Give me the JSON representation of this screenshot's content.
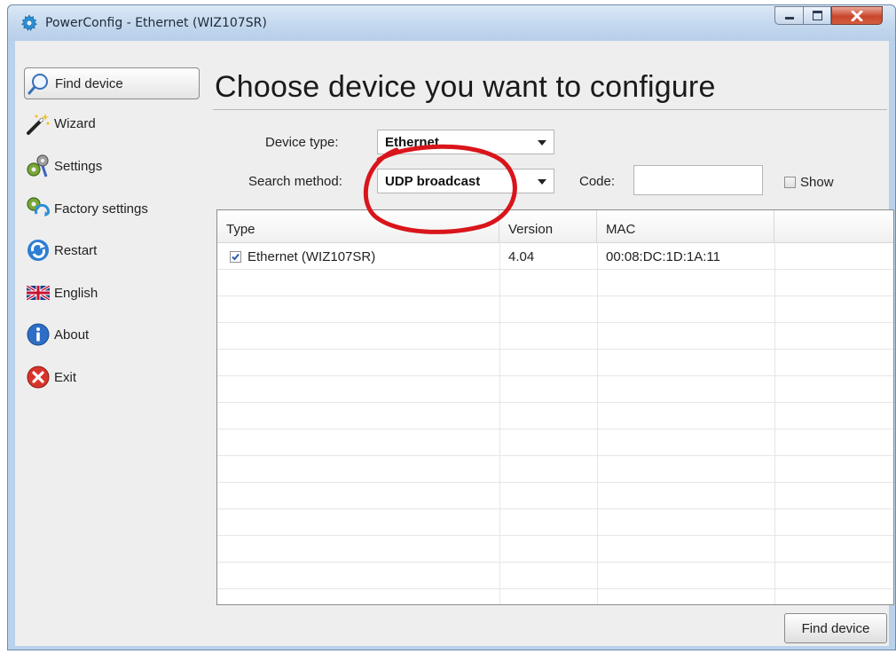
{
  "window": {
    "title": "PowerConfig - Ethernet (WIZ107SR)",
    "controls": [
      "minimize",
      "maximize",
      "close"
    ]
  },
  "sidebar": {
    "items": [
      {
        "label": "Find device",
        "icon": "magnifier-icon",
        "active": true
      },
      {
        "label": "Wizard",
        "icon": "magic-wand-icon"
      },
      {
        "label": "Settings",
        "icon": "gears-icon"
      },
      {
        "label": "Factory settings",
        "icon": "factory-reset-icon"
      },
      {
        "label": "Restart",
        "icon": "refresh-icon"
      },
      {
        "label": "English",
        "icon": "uk-flag-icon"
      },
      {
        "label": "About",
        "icon": "info-icon"
      },
      {
        "label": "Exit",
        "icon": "exit-icon"
      }
    ]
  },
  "main": {
    "title": "Choose device you want to configure",
    "device_type": {
      "label": "Device type:",
      "value": "Ethernet"
    },
    "search_method": {
      "label": "Search method:",
      "value": "UDP broadcast"
    },
    "code": {
      "label": "Code:",
      "value": ""
    },
    "show": {
      "label": "Show",
      "checked": false
    },
    "table": {
      "columns": [
        "Type",
        "Version",
        "MAC",
        ""
      ],
      "rows": [
        {
          "checked": true,
          "type": "Ethernet (WIZ107SR)",
          "version": "4.04",
          "mac": "00:08:DC:1D:1A:11"
        }
      ]
    },
    "find_button": "Find device"
  },
  "colors": {
    "window_frame": "#b9d1ea",
    "client_bg": "#eeeeee",
    "annotation_red": "#d9151b",
    "close_button": "#c9462c"
  }
}
